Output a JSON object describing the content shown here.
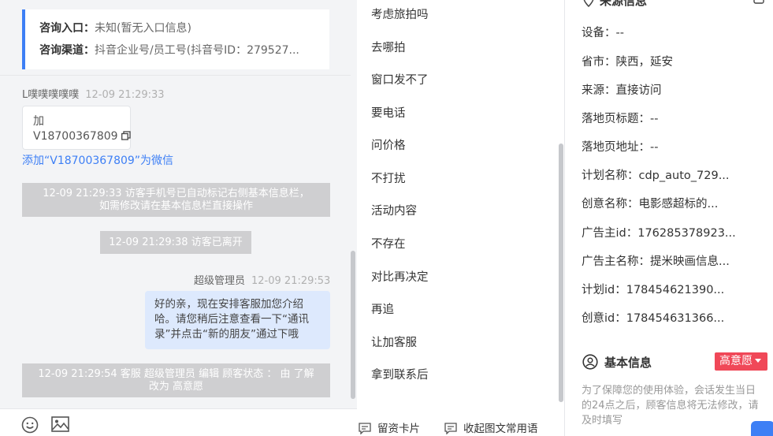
{
  "chat": {
    "info_card": {
      "entry_key": "咨询入口：",
      "entry_value": "未知(暂无入口信息)",
      "channel_key": "咨询渠道：",
      "channel_value": "抖音企业号/员工号(抖音号ID：279527..."
    },
    "visitor_name": "L噗噗噗噗噗",
    "visitor_time": "12-09 21:29:33",
    "visitor_msg_line1": "加",
    "visitor_msg_line2": "V18700367809",
    "add_wechat_link": "添加“V18700367809”为微信",
    "sys1_line1": "12-09 21:29:33 访客手机号已自动标记右侧基本信息栏，",
    "sys1_line2": "如需修改请在基本信息栏直接操作",
    "sys2": "12-09 21:29:38 访客已离开",
    "agent_name": "超级管理员",
    "agent_time": "12-09 21:29:53",
    "agent_msg": "好的亲，现在安排客服加您介绍哈。请您稍后注意查看一下“通讯录”并点击“新的朋友”通过下哦",
    "sys3_line1": "12-09 21:29:54 客服 超级管理员 编辑 顾客状态 ： 由 了解",
    "sys3_line2": "改为 高意愿"
  },
  "quick_replies": {
    "items": [
      "考虑旅拍吗",
      "去哪拍",
      "窗口发不了",
      "要电话",
      "问价格",
      "不打扰",
      "活动内容",
      "不存在",
      "对比再决定",
      "再追",
      "让加客服",
      "拿到联系后"
    ],
    "footer_card": "留资卡片",
    "footer_collapse": "收起图文常用语"
  },
  "side": {
    "source_title": "来源信息",
    "rows": [
      "设备：--",
      "省市：陕西，延安",
      "来源：直接访问",
      "落地页标题：--",
      "落地页地址：--",
      "计划名称：cdp_auto_729...",
      "创意名称：电影感超标的...",
      "广告主id：176285378923...",
      "广告主名称：提米映画信息...",
      "计划id：178454621390...",
      "创意id：178454631366..."
    ],
    "basic_title": "基本信息",
    "intent_badge": "高意愿",
    "notice": "为了保障您的使用体验，会话发生当日的24点之后，顾客信息将无法修改，请及时填写"
  },
  "colors": {
    "accent": "#3d7ff5",
    "badge": "#f04858",
    "system_msg_bg": "#cfcfd1",
    "agent_bubble_bg": "#dde9fd"
  },
  "icons": [
    "copy-icon",
    "emoji-icon",
    "image-icon",
    "card-icon",
    "collapse-icon",
    "user-circle-icon",
    "location-icon",
    "edit-icon"
  ]
}
